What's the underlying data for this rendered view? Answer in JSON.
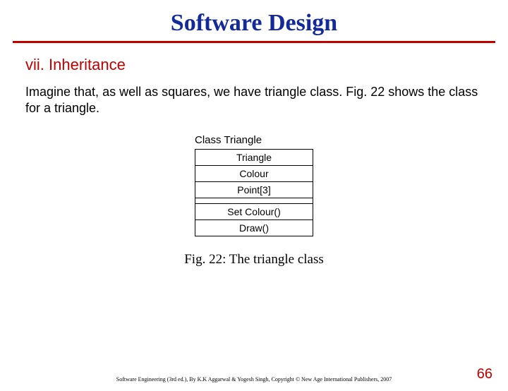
{
  "title": "Software Design",
  "subheading": "vii.  Inheritance",
  "body": "Imagine that, as well as squares, we have triangle class. Fig. 22 shows the class for a triangle.",
  "uml": {
    "class_label": "Class  Triangle",
    "attributes": [
      "Triangle",
      "Colour",
      "Point[3]"
    ],
    "operations": [
      "Set Colour()",
      "Draw()"
    ]
  },
  "caption": "Fig. 22: The triangle class",
  "footer": "Software Engineering (3rd ed.), By K.K Aggarwal & Yogesh Singh, Copyright © New Age International Publishers, 2007",
  "page": "66"
}
